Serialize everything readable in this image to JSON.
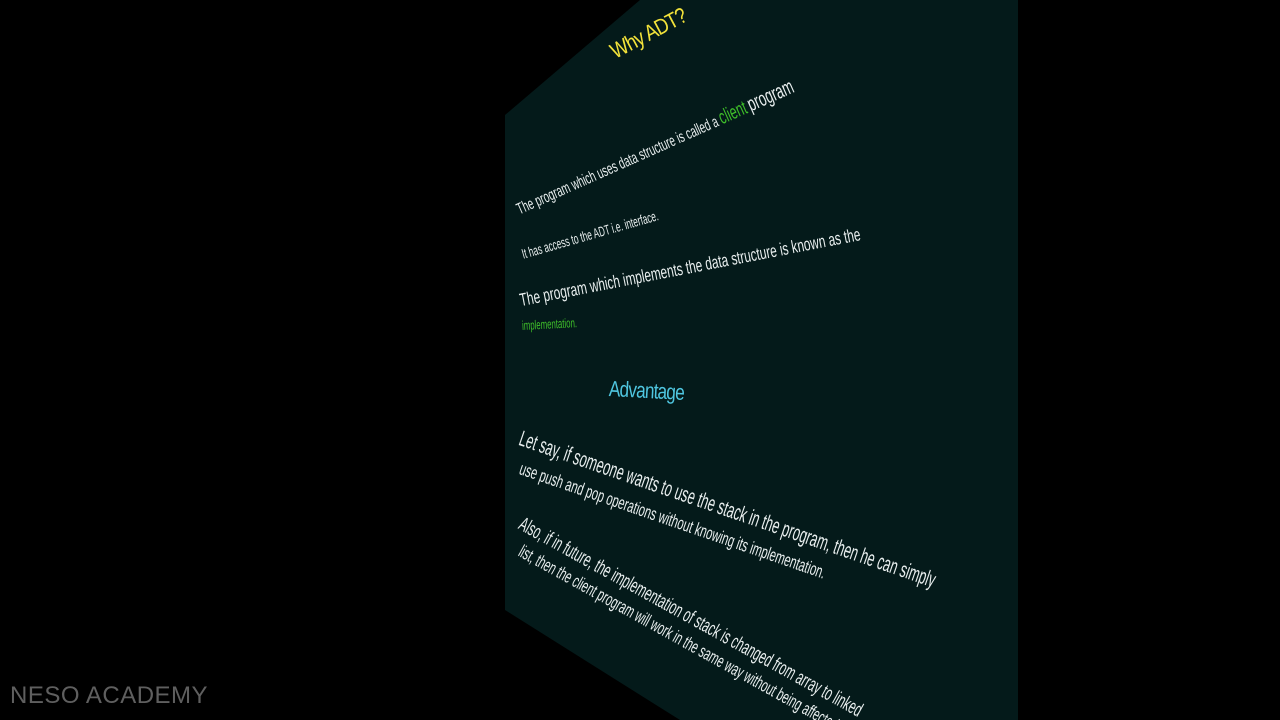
{
  "slide": {
    "title": "Why ADT?",
    "line1": {
      "before": "The program which uses data structure is called a",
      "highlight": "client",
      "after": "program"
    },
    "line2": "It has access to the ADT i.e. interface.",
    "line3": "The program which implements the data structure is known as the",
    "line3_highlight": "implementation.",
    "subtitle": "Advantage",
    "para1_line1": "Let say, if someone wants to use the stack in the program, then he can simply",
    "para1_line2": "use push and pop operations without knowing its implementation.",
    "para2_line1": "Also, if in future, the implementation of stack is changed from array to linked",
    "para2_line2": "list, then the client program will work in the same way without being affected."
  },
  "colors": {
    "background": "#000000",
    "slide_background": "#041a1a",
    "title": "#f2e23a",
    "subtitle": "#4fc6e0",
    "highlight": "#3fbf2a",
    "text": "#e8eeee",
    "watermark": "#5f5f5f"
  },
  "watermark": "NESO ACADEMY"
}
